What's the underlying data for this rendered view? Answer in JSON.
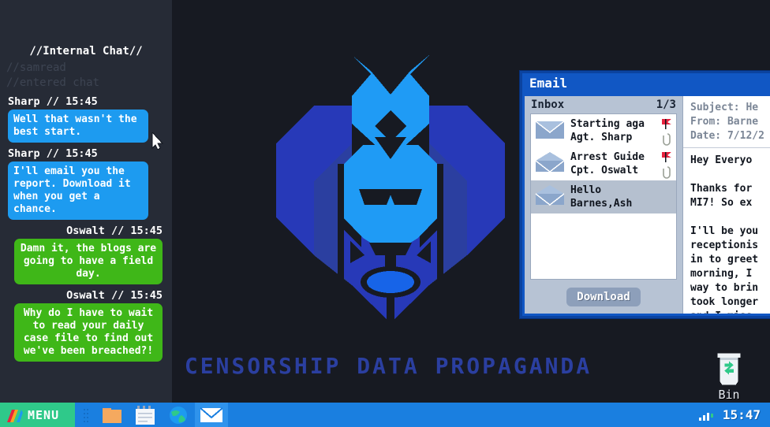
{
  "desktop": {
    "wordart": "Censorship Data Propaganda",
    "logo_name": "lion-head-logo",
    "bin": {
      "label": "Bin",
      "icon": "recycle-bin-icon"
    },
    "colors": {
      "desktop_bg": "#171a22",
      "wordart": "#2b3fa0",
      "lion_light": "#1f9bf5",
      "lion_mid": "#1764e8",
      "lion_dark": "#2739b8",
      "lion_deep": "#2b3fa0"
    }
  },
  "chat": {
    "title": "//Internal Chat//",
    "system_lines": [
      "//samread",
      "//entered chat"
    ],
    "messages": [
      {
        "sender": "Sharp",
        "time": "15:45",
        "meta": "Sharp // 15:45",
        "text": "Well that wasn't the best start.",
        "side": "left",
        "color": "#1d9bf0"
      },
      {
        "sender": "Sharp",
        "time": "15:45",
        "meta": "Sharp // 15:45",
        "text": "I'll email you the report. Download it when you get a chance.",
        "side": "left",
        "color": "#1d9bf0"
      },
      {
        "sender": "Oswalt",
        "time": "15:45",
        "meta": "Oswalt // 15:45",
        "text": "Damn it, the blogs are going to have a field day.",
        "side": "right",
        "color": "#3fb718"
      },
      {
        "sender": "Oswalt",
        "time": "15:45",
        "meta": "Oswalt // 15:45",
        "text": "Why do I have to wait to read your daily case file to find out we've been breached?!",
        "side": "right",
        "color": "#3fb718"
      }
    ]
  },
  "email_window": {
    "title": "Email",
    "inbox": {
      "label": "Inbox",
      "counter": "1/3",
      "messages": [
        {
          "subject": "Starting aga",
          "from": "Agt. Sharp",
          "flagged": true,
          "attachment": true,
          "selected": false,
          "envelope": "closed-envelope-icon"
        },
        {
          "subject": "Arrest Guide",
          "from": "Cpt. Oswalt",
          "flagged": true,
          "attachment": true,
          "selected": false,
          "envelope": "open-envelope-icon"
        },
        {
          "subject": "Hello",
          "from": "Barnes,Ash",
          "flagged": false,
          "attachment": false,
          "selected": true,
          "envelope": "open-envelope-icon"
        }
      ]
    },
    "download_button": "Download",
    "reading_pane": {
      "subject_line": "Subject: He",
      "from_line": "From: Barne",
      "date_line": "Date: 7/12/2",
      "body_lines": [
        "Hey Everyo",
        "Thanks for\nMI7! So ex",
        "I'll be you\nreceptionis\nin to greet\nmorning, I\nway to brin\ntook longer\nand I miss"
      ]
    }
  },
  "taskbar": {
    "start_label": "MENU",
    "start_icon": "rainbow-start-icon",
    "icons": [
      {
        "name": "folder-icon",
        "active": false
      },
      {
        "name": "notepad-icon",
        "active": false
      },
      {
        "name": "globe-browser-icon",
        "active": false
      },
      {
        "name": "mail-icon",
        "active": true
      }
    ],
    "tray": {
      "signal_icon": "signal-bars-icon",
      "clock": "15:47"
    }
  }
}
